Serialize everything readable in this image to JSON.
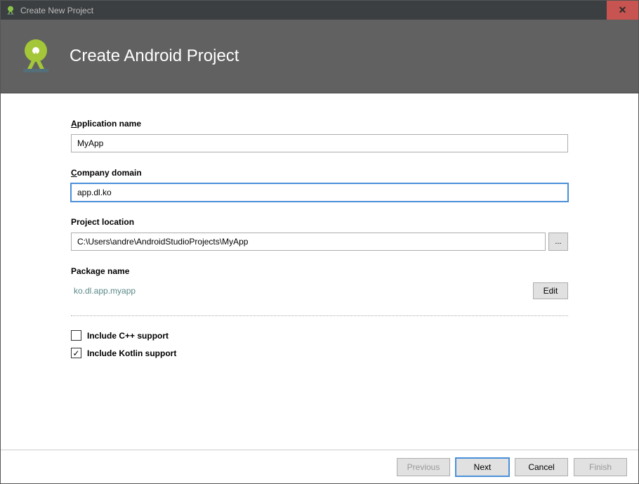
{
  "window": {
    "title": "Create New Project"
  },
  "header": {
    "title": "Create Android Project"
  },
  "fields": {
    "app_name": {
      "label_prefix": "A",
      "label_rest": "pplication name",
      "value": "MyApp"
    },
    "company_domain": {
      "label_prefix": "C",
      "label_rest": "ompany domain",
      "value": "app.dl.ko"
    },
    "project_location": {
      "label": "Project location",
      "value": "C:\\Users\\andre\\AndroidStudioProjects\\MyApp",
      "browse_label": "..."
    },
    "package_name": {
      "label": "Package name",
      "value": "ko.dl.app.myapp",
      "edit_label": "Edit"
    }
  },
  "checkboxes": {
    "cpp": {
      "label": "Include C++ support",
      "checked": false
    },
    "kotlin": {
      "label": "Include Kotlin support",
      "checked": true
    }
  },
  "footer": {
    "previous": "Previous",
    "next": "Next",
    "cancel": "Cancel",
    "finish": "Finish"
  }
}
